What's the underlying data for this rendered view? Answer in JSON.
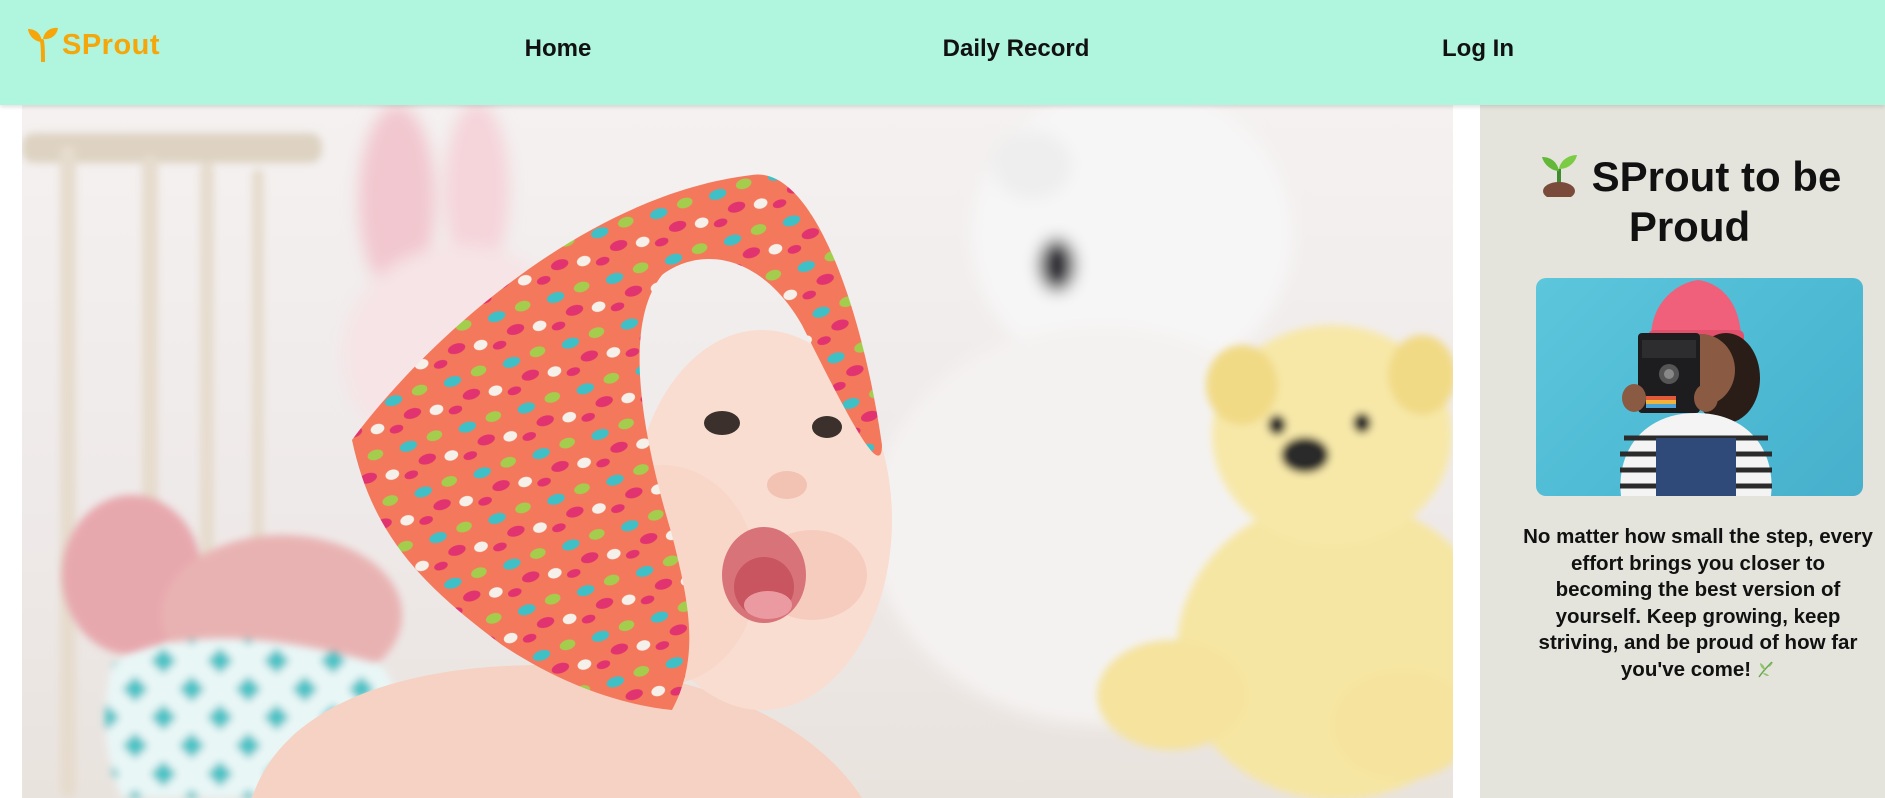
{
  "header": {
    "brand": "SProut",
    "nav": [
      {
        "id": "home",
        "label": "Home"
      },
      {
        "id": "daily-record",
        "label": "Daily Record"
      },
      {
        "id": "login",
        "label": "Log In"
      }
    ],
    "colors": {
      "background": "#b0f5de",
      "brand": "#f5a60b"
    }
  },
  "hero": {
    "image": "baby-with-headscarf-and-teddy-bears-photo"
  },
  "sidebar": {
    "title": "SProut to be Proud",
    "title_icon": "seedling-emoji",
    "image": "child-with-camera-photo",
    "quote": "No matter how small the step, every effort brings you closer to becoming the best version of yourself. Keep growing, keep striving, and be proud of how far you've come!",
    "quote_icon": "herb-emoji",
    "colors": {
      "background": "#e4e4dd"
    }
  }
}
